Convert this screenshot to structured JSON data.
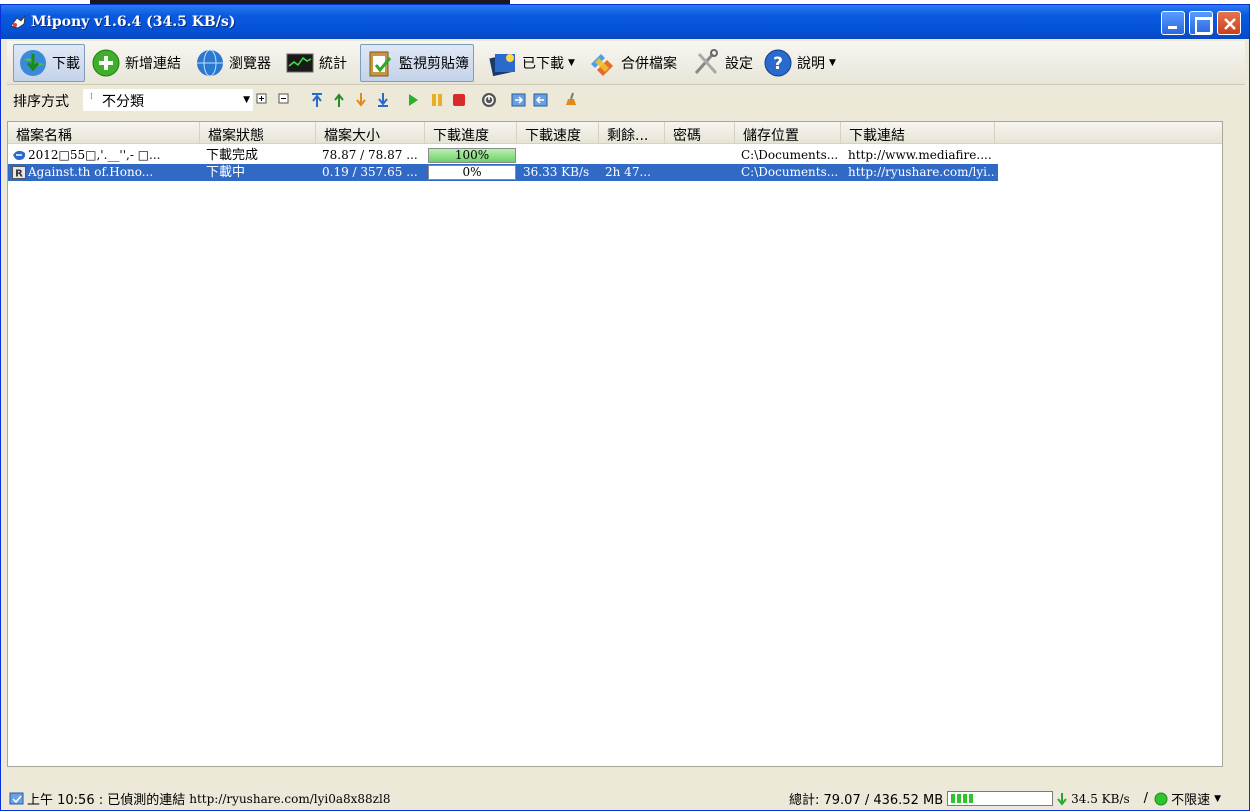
{
  "window": {
    "title": "Mipony v1.6.4 (34.5 KB/s)"
  },
  "toolbar": {
    "download": "下載",
    "add_link": "新增連結",
    "browser": "瀏覽器",
    "stats": "統計",
    "monitor_clipboard": "監視剪貼簿",
    "downloaded": "已下載",
    "merge_files": "合併檔案",
    "settings": "設定",
    "help": "說明"
  },
  "sortbar": {
    "label": "排序方式",
    "selected": "不分類"
  },
  "table": {
    "columns": [
      "檔案名稱",
      "檔案狀態",
      "檔案大小",
      "下載進度",
      "下載速度",
      "剩餘...",
      "密碼",
      "儲存位置",
      "下載連結"
    ],
    "rows": [
      {
        "name": "2012□55□,'.__'',- □...",
        "status": "下載完成",
        "size": "78.87 / 78.87 ...",
        "progress_label": "100%",
        "progress": 1.0,
        "speed": "",
        "remaining": "",
        "password": "",
        "location": "C:\\Documents...",
        "link": "http://www.mediafire...."
      },
      {
        "name": "Against.th        of.Hono...",
        "status": "下載中",
        "size": "0.19 / 357.65 ...",
        "progress_label": "0%",
        "progress": 0.0,
        "speed": "36.33 KB/s",
        "remaining": "2h 47...",
        "password": "",
        "location": "C:\\Documents...",
        "link": "http://ryushare.com/lyi..."
      }
    ]
  },
  "status": {
    "time_message": "上午 10:56 : 已偵測的連結",
    "detected_url": "http://ryushare.com/lyi0a8x88zl8",
    "total_label": "總計: 79.07 / 436.52 MB",
    "speed": "34.5 KB/s",
    "limit": "不限速"
  },
  "colors": {
    "title_bar": "#0a5ae0",
    "selection": "#316ac5",
    "progress_fill": "#6fd066"
  }
}
